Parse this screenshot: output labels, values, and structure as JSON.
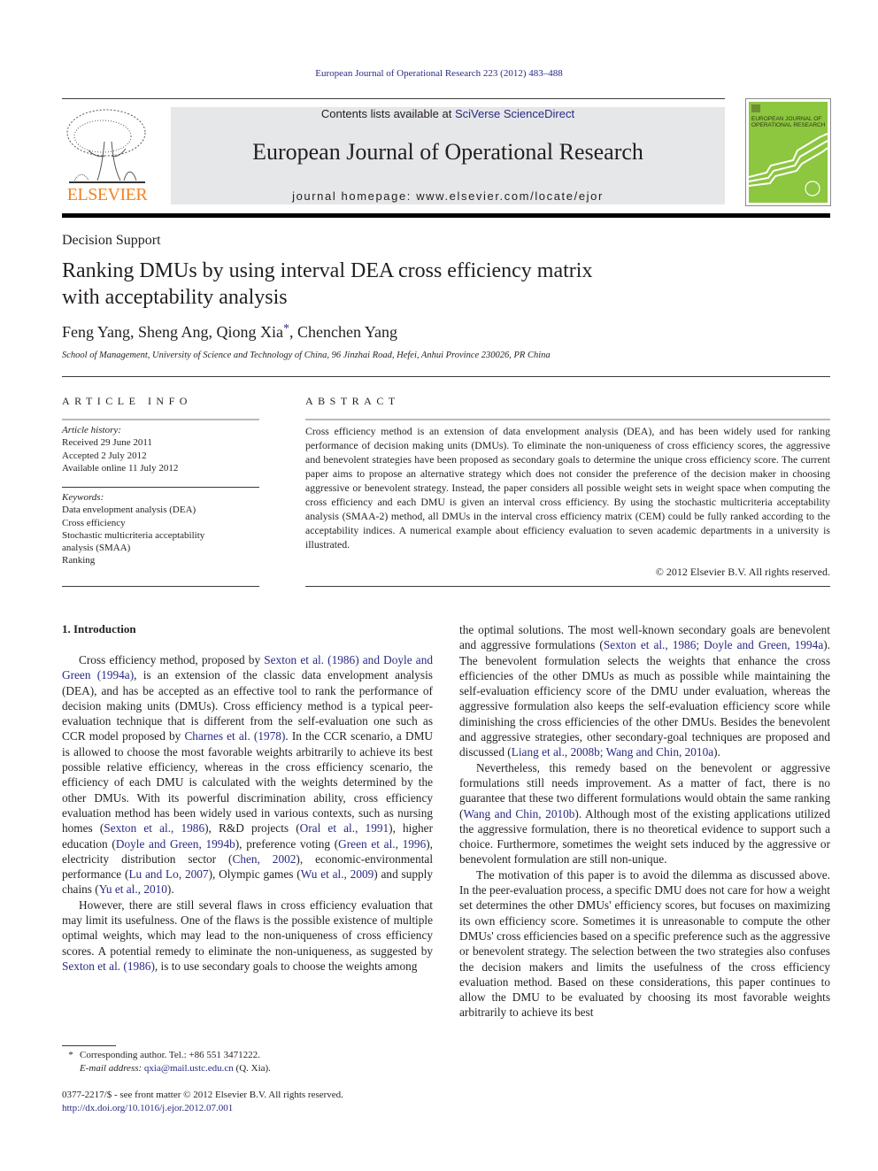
{
  "running_head": "European Journal of Operational Research 223 (2012) 483–488",
  "banner": {
    "contents_prefix": "Contents lists available at ",
    "contents_link": "SciVerse ScienceDirect",
    "journal_title": "European Journal of Operational Research",
    "homepage": "journal homepage: www.elsevier.com/locate/ejor"
  },
  "publisher": {
    "logo_text": "ELSEVIER",
    "logo_color": "#f58220"
  },
  "cover": {
    "title_line1": "EUROPEAN JOURNAL OF",
    "title_line2": "OPERATIONAL RESEARCH",
    "color": "#8dc63f"
  },
  "article": {
    "section": "Decision Support",
    "title_line1": "Ranking DMUs by using interval DEA cross efficiency matrix",
    "title_line2": "with acceptability analysis",
    "authors_pre": "Feng Yang, Sheng Ang, Qiong Xia",
    "authors_star": "*",
    "authors_post": ", Chenchen Yang",
    "affiliation": "School of Management, University of Science and Technology of China, 96 Jinzhai Road, Hefei, Anhui Province 230026, PR China"
  },
  "article_info": {
    "heading": "ARTICLE INFO",
    "history_label": "Article history:",
    "history": [
      "Received 29 June 2011",
      "Accepted 2 July 2012",
      "Available online 11 July 2012"
    ],
    "keywords_label": "Keywords:",
    "keywords": [
      "Data envelopment analysis (DEA)",
      "Cross efficiency",
      "Stochastic multicriteria acceptability",
      "analysis (SMAA)",
      "Ranking"
    ]
  },
  "abstract": {
    "heading": "ABSTRACT",
    "text": "Cross efficiency method is an extension of data envelopment analysis (DEA), and has been widely used for ranking performance of decision making units (DMUs). To eliminate the non-uniqueness of cross efficiency scores, the aggressive and benevolent strategies have been proposed as secondary goals to determine the unique cross efficiency score. The current paper aims to propose an alternative strategy which does not consider the preference of the decision maker in choosing aggressive or benevolent strategy. Instead, the paper considers all possible weight sets in weight space when computing the cross efficiency and each DMU is given an interval cross efficiency. By using the stochastic multicriteria acceptability analysis (SMAA-2) method, all DMUs in the interval cross efficiency matrix (CEM) could be fully ranked according to the acceptability indices. A numerical example about efficiency evaluation to seven academic departments in a university is illustrated.",
    "copyright": "© 2012 Elsevier B.V. All rights reserved."
  },
  "introduction": {
    "heading": "1. Introduction",
    "p1": [
      {
        "t": "Cross efficiency method, proposed by "
      },
      {
        "t": "Sexton et al. (1986) and Doyle and Green (1994a)",
        "link": true
      },
      {
        "t": ", is an extension of the classic data envelopment analysis (DEA), and has be accepted as an effective tool to rank the performance of decision making units (DMUs). Cross efficiency method is a typical peer-evaluation technique that is different from the self-evaluation one such as CCR model proposed by "
      },
      {
        "t": "Charnes et al. (1978)",
        "link": true
      },
      {
        "t": ". In the CCR scenario, a DMU is allowed to choose the most favorable weights arbitrarily to achieve its best possible relative efficiency, whereas in the cross efficiency scenario, the efficiency of each DMU is calculated with the weights determined by the other DMUs. With its powerful discrimination ability, cross efficiency evaluation method has been widely used in various contexts, such as nursing homes ("
      },
      {
        "t": "Sexton et al., 1986",
        "link": true
      },
      {
        "t": "), R&D projects ("
      },
      {
        "t": "Oral et al., 1991",
        "link": true
      },
      {
        "t": "), higher education ("
      },
      {
        "t": "Doyle and Green, 1994b",
        "link": true
      },
      {
        "t": "), preference voting ("
      },
      {
        "t": "Green et al., 1996",
        "link": true
      },
      {
        "t": "), electricity distribution sector ("
      },
      {
        "t": "Chen, 2002",
        "link": true
      },
      {
        "t": "), economic-environmental performance ("
      },
      {
        "t": "Lu and Lo, 2007",
        "link": true
      },
      {
        "t": "), Olympic games ("
      },
      {
        "t": "Wu et al., 2009",
        "link": true
      },
      {
        "t": ") and supply chains ("
      },
      {
        "t": "Yu et al., 2010",
        "link": true
      },
      {
        "t": ")."
      }
    ],
    "p2": [
      {
        "t": "However, there are still several flaws in cross efficiency evaluation that may limit its usefulness. One of the flaws is the possible existence of multiple optimal weights, which may lead to the non-uniqueness of cross efficiency scores. A potential remedy to eliminate the non-uniqueness, as suggested by "
      },
      {
        "t": "Sexton et al. (1986)",
        "link": true
      },
      {
        "t": ", is to use secondary goals to choose the weights among the optimal solutions. The most well-known secondary goals are benevolent and aggressive formulations ("
      },
      {
        "t": "Sexton et al., 1986; Doyle and Green, 1994a",
        "link": true
      },
      {
        "t": "). The benevolent formulation selects the weights that enhance the cross efficiencies of the other DMUs as much as possible while maintaining the self-evaluation efficiency score of the DMU under evaluation, whereas the aggressive formulation also keeps the self-evaluation efficiency score while diminishing the cross efficiencies of the other DMUs. Besides the benevolent and aggressive strategies, other secondary-goal techniques are proposed and discussed ("
      },
      {
        "t": "Liang et al., 2008b; Wang and Chin, 2010a",
        "link": true
      },
      {
        "t": ")."
      }
    ],
    "p3": [
      {
        "t": "Nevertheless, this remedy based on the benevolent or aggressive formulations still needs improvement. As a matter of fact, there is no guarantee that these two different formulations would obtain the same ranking ("
      },
      {
        "t": "Wang and Chin, 2010b",
        "link": true
      },
      {
        "t": "). Although most of the existing applications utilized the aggressive formulation, there is no theoretical evidence to support such a choice. Furthermore, sometimes the weight sets induced by the aggressive or benevolent formulation are still non-unique."
      }
    ],
    "p4": [
      {
        "t": "The motivation of this paper is to avoid the dilemma as discussed above. In the peer-evaluation process, a specific DMU does not care for how a weight set determines the other DMUs' efficiency scores, but focuses on maximizing its own efficiency score. Sometimes it is unreasonable to compute the other DMUs' cross efficiencies based on a specific preference such as the aggressive or benevolent strategy. The selection between the two strategies also confuses the decision makers and limits the usefulness of the cross efficiency evaluation method. Based on these considerations, this paper continues to allow the DMU to be evaluated by choosing its most favorable weights arbitrarily to achieve its best"
      }
    ]
  },
  "footnote": {
    "star": "*",
    "corresponding": "Corresponding author. Tel.: +86 551 3471222.",
    "email_label": "E-mail address: ",
    "email": "qxia@mail.ustc.edu.cn",
    "email_suffix": " (Q. Xia)."
  },
  "issn_line": "0377-2217/$ - see front matter © 2012 Elsevier B.V. All rights reserved.",
  "doi": "http://dx.doi.org/10.1016/j.ejor.2012.07.001"
}
